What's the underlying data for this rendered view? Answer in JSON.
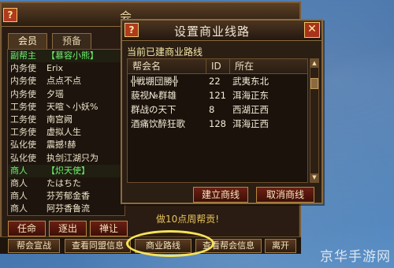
{
  "guild_panel": {
    "title": "会",
    "help_label": "?",
    "tabs": [
      {
        "label": "会员"
      },
      {
        "label": "预备"
      }
    ],
    "members": [
      {
        "rank": "副帮主",
        "name": "【慕容小熊】",
        "highlight": true
      },
      {
        "rank": "内务使",
        "name": "Erix",
        "highlight": false
      },
      {
        "rank": "内务使",
        "name": "点点不点",
        "highlight": false
      },
      {
        "rank": "内务使",
        "name": "夕瑶",
        "highlight": false
      },
      {
        "rank": "工务使",
        "name": "天喧丶小妖%",
        "highlight": false
      },
      {
        "rank": "工务使",
        "name": "南宫阙",
        "highlight": false
      },
      {
        "rank": "工务使",
        "name": "虚拟人生",
        "highlight": false
      },
      {
        "rank": "弘化使",
        "name": "震撼!赫",
        "highlight": false
      },
      {
        "rank": "弘化使",
        "name": "执剑江湖只为",
        "highlight": false
      },
      {
        "rank": "商人",
        "name": "【炽天使】",
        "highlight": true
      },
      {
        "rank": "商人",
        "name": "たはちた",
        "highlight": false
      },
      {
        "rank": "商人",
        "name": "芬芳郁金香",
        "highlight": false
      },
      {
        "rank": "商人",
        "name": "阿芬香鲁流",
        "highlight": false
      }
    ],
    "actions": [
      {
        "label": "任命"
      },
      {
        "label": "逐出"
      },
      {
        "label": "禅让"
      }
    ],
    "notice_text": "做10点周帮贡!",
    "bottom_buttons": [
      {
        "label": "帮会宣战"
      },
      {
        "label": "查看同盟信息"
      },
      {
        "label": "商业路线"
      },
      {
        "label": "查看帮会信息"
      },
      {
        "label": "离开"
      }
    ]
  },
  "route_dialog": {
    "title": "设置商业线路",
    "help_label": "?",
    "close_label": "✕",
    "subtitle": "当前已建商业路线",
    "columns": [
      "帮会名",
      "ID",
      "所在"
    ],
    "rows": [
      {
        "name": "╬戦堋団勝╬",
        "id": "22",
        "location": "武夷东北"
      },
      {
        "name": "藐视№群雄",
        "id": "121",
        "location": "洱海正东"
      },
      {
        "name": "群战の天下",
        "id": "8",
        "location": "西湖正西"
      },
      {
        "name": "酒痛饮醉狂歌",
        "id": "128",
        "location": "洱海正西"
      }
    ],
    "buttons": {
      "build": "建立商线",
      "cancel": "取消商线"
    }
  },
  "watermark": "京华手游网"
}
